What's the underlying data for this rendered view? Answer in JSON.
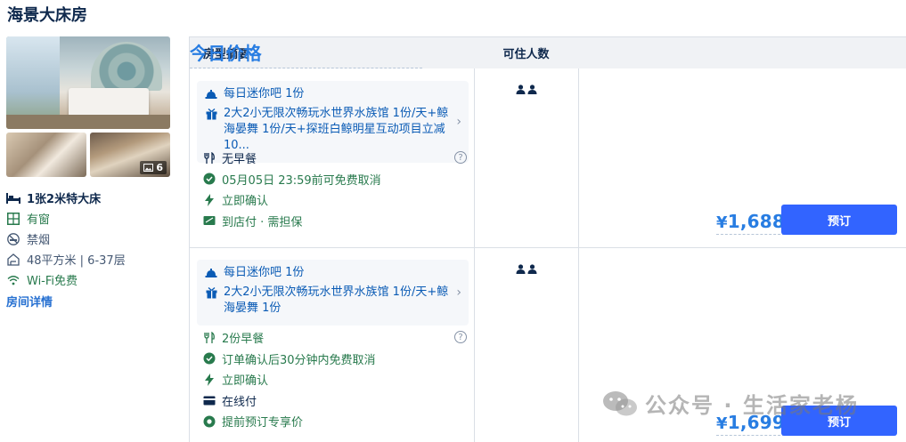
{
  "room": {
    "title": "海景大床房",
    "photo_count": "6",
    "attributes": [
      {
        "icon": "bed-icon",
        "label": "1张2米特大床"
      },
      {
        "icon": "window-icon",
        "label": "有窗"
      },
      {
        "icon": "no-smoking-icon",
        "label": "禁烟"
      },
      {
        "icon": "area-icon",
        "label": "48平方米 | 6-37层"
      },
      {
        "icon": "wifi-icon",
        "label": "Wi-Fi免费"
      }
    ],
    "detail_link": "房间详情"
  },
  "table": {
    "headers": {
      "summary": "房型摘要",
      "guests": "可住人数",
      "price": "今日价格"
    }
  },
  "rates": [
    {
      "benefits": [
        {
          "icon": "minibar-icon",
          "text": "每日迷你吧 1份"
        },
        {
          "icon": "gift-icon",
          "text": "2大2小无限次畅玩水世界水族馆 1份/天+鲸海晏舞 1份/天+探班白鲸明星互动项目立减10..."
        }
      ],
      "policies": [
        {
          "icon": "fork-knife-icon",
          "text": "无早餐",
          "style": "dark",
          "help": "?"
        },
        {
          "icon": "check-circle-icon",
          "text": "05月05日 23:59前可免费取消",
          "style": "green"
        },
        {
          "icon": "lightning-icon",
          "text": "立即确认",
          "style": "green"
        },
        {
          "icon": "pay-at-hotel-icon",
          "text": "到店付 · 需担保",
          "style": "green"
        }
      ],
      "guests": 2,
      "currency": "¥",
      "price": "1,688",
      "book_label": "预订"
    },
    {
      "benefits": [
        {
          "icon": "minibar-icon",
          "text": "每日迷你吧 1份"
        },
        {
          "icon": "gift-icon",
          "text": "2大2小无限次畅玩水世界水族馆 1份/天+鲸海晏舞 1份"
        }
      ],
      "policies": [
        {
          "icon": "fork-knife-icon",
          "text": "2份早餐",
          "style": "green",
          "help": "?"
        },
        {
          "icon": "check-circle-icon",
          "text": "订单确认后30分钟内免费取消",
          "style": "green"
        },
        {
          "icon": "lightning-icon",
          "text": "立即确认",
          "style": "green"
        },
        {
          "icon": "card-icon",
          "text": "在线付",
          "style": "dark"
        },
        {
          "icon": "dot-circle-icon",
          "text": "提前预订专享价",
          "style": "green"
        }
      ],
      "guests": 2,
      "currency": "¥",
      "price": "1,699",
      "book_label": "预订"
    }
  ],
  "watermark": "公众号 · 生活家老杨",
  "colors": {
    "accent": "#3264ff",
    "price": "#287de2",
    "green": "#287a4d",
    "benefit": "#0a5bb5",
    "text": "#0f294d"
  }
}
